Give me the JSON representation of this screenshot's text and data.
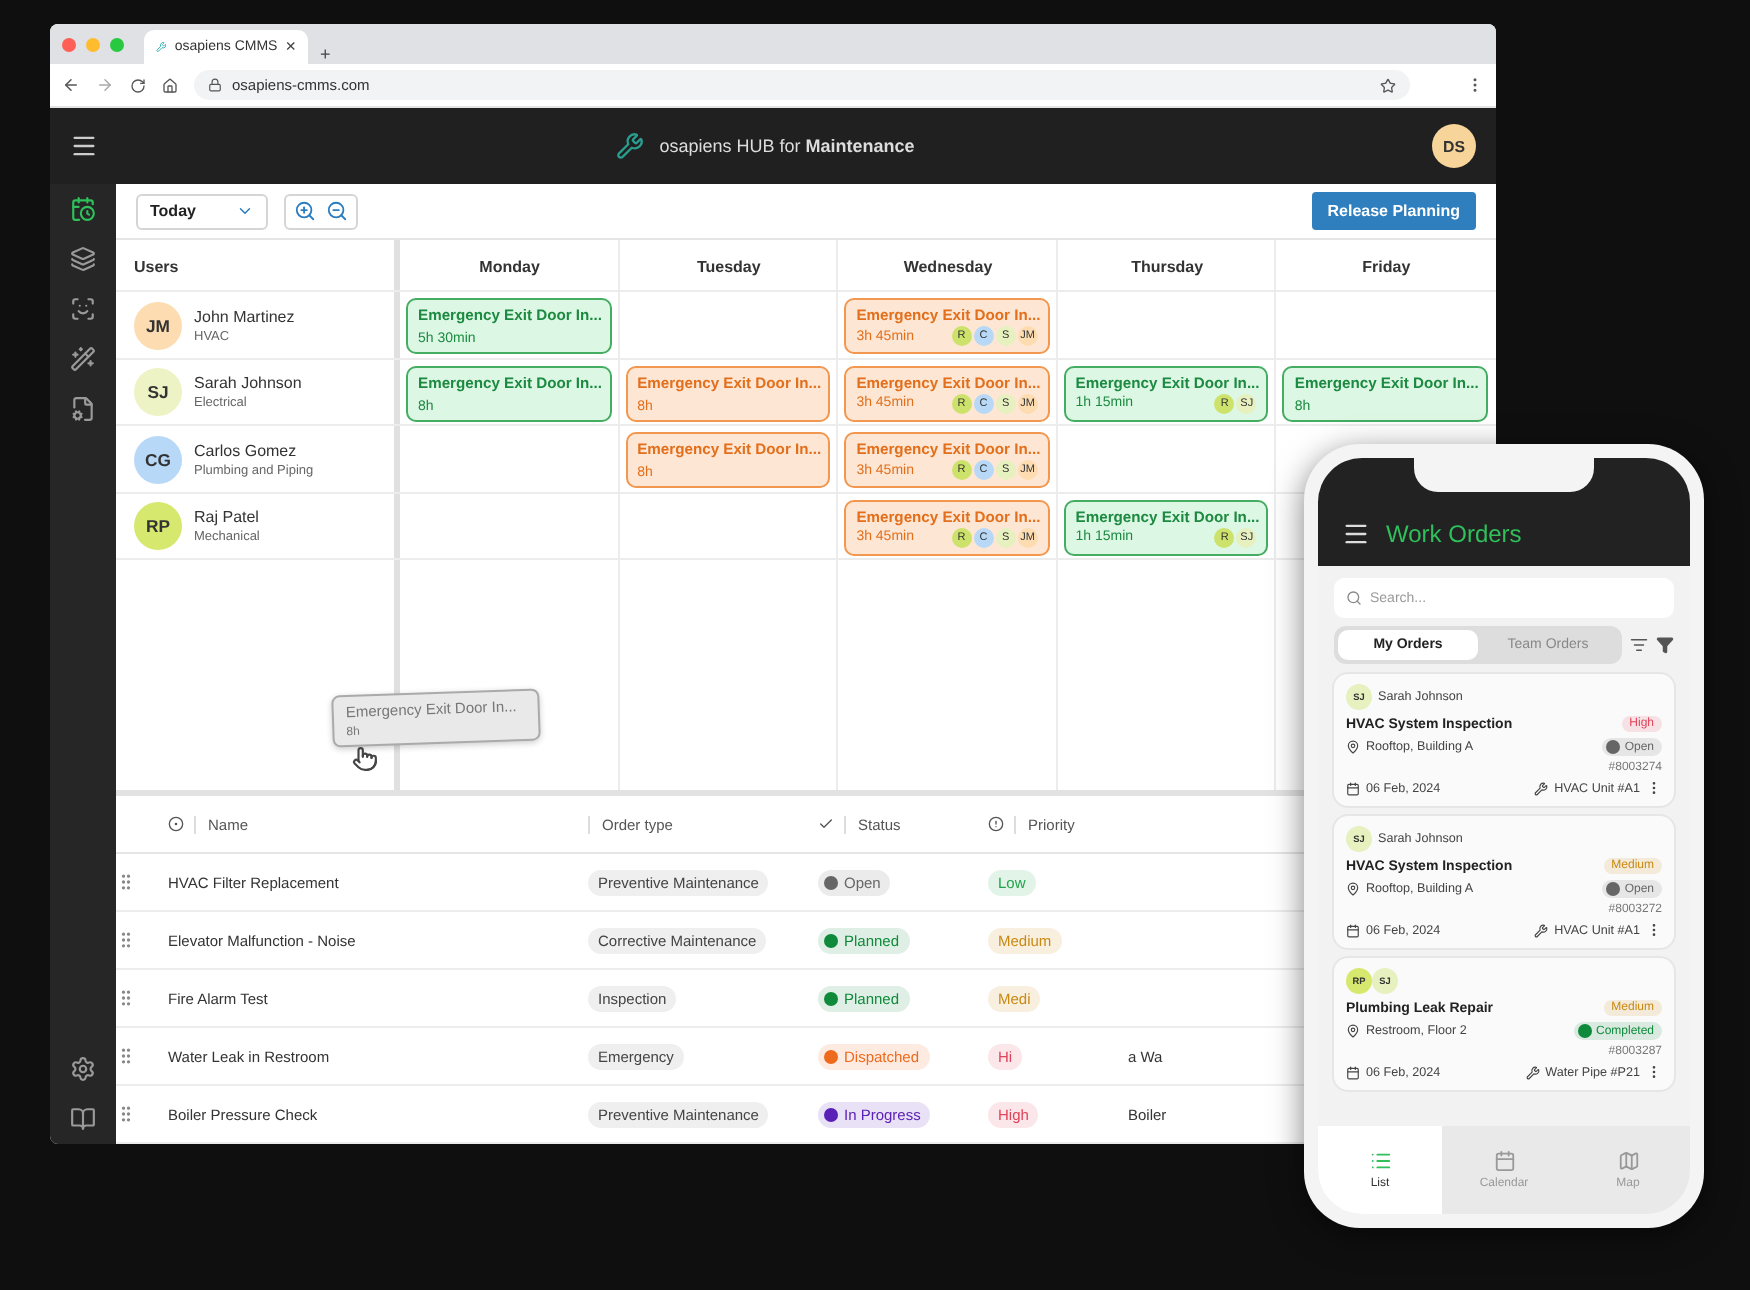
{
  "browser": {
    "tab_title": "osapiens CMMS",
    "tab_close": "×",
    "new_tab": "+",
    "url": "osapiens-cmms.com"
  },
  "header": {
    "title": "osapiens HUB for **Maintenance**",
    "avatar": "DS"
  },
  "sidebar": {
    "items": [
      {
        "kind": "planning",
        "selected": true
      },
      {
        "kind": "layers",
        "selected": false
      },
      {
        "kind": "scan",
        "selected": false
      },
      {
        "kind": "wand",
        "selected": false
      },
      {
        "kind": "file",
        "selected": false
      }
    ],
    "bottom_items": [
      {
        "kind": "settings",
        "selected": false
      },
      {
        "kind": "book",
        "selected": false
      }
    ]
  },
  "toolbar": {
    "date_select": "Today",
    "release_button": "Release Planning"
  },
  "planner": {
    "users_header": "Users",
    "days": [
      "Monday",
      "Tuesday",
      "Wednesday",
      "Thursday",
      "Friday"
    ],
    "users": [
      {
        "initials": "JM",
        "name": "John Martinez",
        "role": "HVAC",
        "color": "#fcdcb0",
        "slots": [
          {
            "kind": "planned",
            "title": "Emergency Exit Door In...",
            "duration": "5h 30min"
          },
          {
            "kind": "empty"
          },
          {
            "kind": "dispatched",
            "title": "Emergency Exit Door In...",
            "duration": "3h 45min",
            "assignees": [
              {
                "initials": "R",
                "color": "#cde26a"
              },
              {
                "initials": "C",
                "color": "#b7d8f7"
              },
              {
                "initials": "S",
                "color": "#e7f0bf"
              },
              {
                "initials": "JM",
                "color": "#fcdcb0"
              }
            ]
          },
          {
            "kind": "empty"
          },
          {
            "kind": "empty"
          }
        ]
      },
      {
        "initials": "SJ",
        "name": "Sarah Johnson",
        "role": "Electrical",
        "color": "#edf3c4",
        "slots": [
          {
            "kind": "planned",
            "title": "Emergency Exit Door In...",
            "duration": "8h"
          },
          {
            "kind": "dispatched",
            "title": "Emergency Exit Door In...",
            "duration": "8h"
          },
          {
            "kind": "dispatched",
            "title": "Emergency Exit Door In...",
            "duration": "3h 45min",
            "assignees": [
              {
                "initials": "R",
                "color": "#cde26a"
              },
              {
                "initials": "C",
                "color": "#b7d8f7"
              },
              {
                "initials": "S",
                "color": "#e7f0bf"
              },
              {
                "initials": "JM",
                "color": "#fcdcb0"
              }
            ]
          },
          {
            "kind": "planned",
            "title": "Emergency Exit Door In...",
            "duration": "1h 15min",
            "assignees": [
              {
                "initials": "R",
                "color": "#cde26a"
              },
              {
                "initials": "SJ",
                "color": "#e7f0bf"
              }
            ]
          },
          {
            "kind": "planned",
            "title": "Emergency Exit Door In...",
            "duration": "8h"
          }
        ]
      },
      {
        "initials": "CG",
        "name": "Carlos Gomez",
        "role": "Plumbing and Piping",
        "color": "#b7d8f7",
        "slots": [
          {
            "kind": "empty"
          },
          {
            "kind": "dispatched",
            "title": "Emergency Exit Door In...",
            "duration": "8h"
          },
          {
            "kind": "dispatched",
            "title": "Emergency Exit Door In...",
            "duration": "3h 45min",
            "assignees": [
              {
                "initials": "R",
                "color": "#cde26a"
              },
              {
                "initials": "C",
                "color": "#b7d8f7"
              },
              {
                "initials": "S",
                "color": "#e7f0bf"
              },
              {
                "initials": "JM",
                "color": "#fcdcb0"
              }
            ]
          },
          {
            "kind": "empty"
          },
          {
            "kind": "empty"
          }
        ]
      },
      {
        "initials": "RP",
        "name": "Raj Patel",
        "role": "Mechanical",
        "color": "#d6e86e",
        "slots": [
          {
            "kind": "empty"
          },
          {
            "kind": "empty"
          },
          {
            "kind": "dispatched",
            "title": "Emergency Exit Door In...",
            "duration": "3h 45min",
            "assignees": [
              {
                "initials": "R",
                "color": "#cde26a"
              },
              {
                "initials": "C",
                "color": "#b7d8f7"
              },
              {
                "initials": "S",
                "color": "#e7f0bf"
              },
              {
                "initials": "JM",
                "color": "#fcdcb0"
              }
            ]
          },
          {
            "kind": "planned",
            "title": "Emergency Exit Door In...",
            "duration": "1h 15min",
            "assignees": [
              {
                "initials": "R",
                "color": "#cde26a"
              },
              {
                "initials": "SJ",
                "color": "#e7f0bf"
              }
            ]
          },
          {
            "kind": "empty"
          }
        ]
      }
    ],
    "drag_preview": {
      "title": "Emergency Exit Door In...",
      "duration": "8h"
    }
  },
  "table": {
    "columns": [
      {
        "label": "Name",
        "kind": "name"
      },
      {
        "label": "Order type",
        "kind": "type"
      },
      {
        "label": "Status",
        "kind": "status"
      },
      {
        "label": "Priority",
        "kind": "priority"
      }
    ],
    "rows": [
      {
        "name": "HVAC Filter Replacement",
        "order_type": "Preventive Maintenance",
        "status": {
          "label": "Open",
          "color": "#666666"
        },
        "priority": {
          "label": "Low",
          "color": "#22a34a"
        }
      },
      {
        "name": "Elevator Malfunction - Noise",
        "order_type": "Corrective Maintenance",
        "status": {
          "label": "Planned",
          "color": "#0e8a3a"
        },
        "priority": {
          "label": "Medium",
          "color": "#c98a12"
        }
      },
      {
        "name": "Fire Alarm Test",
        "order_type": "Inspection",
        "status": {
          "label": "Planned",
          "color": "#0e8a3a"
        },
        "priority": {
          "label": "Medi",
          "color": "#c98a12"
        }
      },
      {
        "name": "Water Leak in Restroom",
        "order_type": "Emergency",
        "status": {
          "label": "Dispatched",
          "color": "#ee6a1c"
        },
        "priority": {
          "label": "Hi",
          "color": "#e0435a"
        },
        "column_5": "a Wa"
      },
      {
        "name": "Boiler Pressure Check",
        "order_type": "Preventive Maintenance",
        "status": {
          "label": "In Progress",
          "color": "#5b21b6"
        },
        "priority": {
          "label": "High",
          "color": "#e0435a"
        },
        "column_5": "Boiler"
      }
    ]
  },
  "phone": {
    "title": "Work Orders",
    "search_placeholder": "Search...",
    "tabs": [
      {
        "label": "My Orders",
        "selected": true
      },
      {
        "label": "Team Orders",
        "selected": false
      }
    ],
    "orders": [
      {
        "assignees": [
          {
            "initials": "SJ",
            "color": "#e7f0bf"
          }
        ],
        "assignee_name": "Sarah Johnson",
        "title": "HVAC System Inspection",
        "location": "Rooftop, Building A",
        "date": "06 Feb, 2024",
        "priority": {
          "label": "High",
          "color": "#e0435a"
        },
        "status": {
          "label": "Open",
          "color": "#666666"
        },
        "number": "#8003274",
        "asset": "HVAC Unit #A1"
      },
      {
        "assignees": [
          {
            "initials": "SJ",
            "color": "#e7f0bf"
          }
        ],
        "assignee_name": "Sarah Johnson",
        "title": "HVAC System Inspection",
        "location": "Rooftop, Building A",
        "date": "06 Feb, 2024",
        "priority": {
          "label": "Medium",
          "color": "#c98a12"
        },
        "status": {
          "label": "Open",
          "color": "#666666"
        },
        "number": "#8003272",
        "asset": "HVAC Unit #A1"
      },
      {
        "assignees": [
          {
            "initials": "RP",
            "color": "#d6e86e"
          },
          {
            "initials": "SJ",
            "color": "#e7f0bf"
          }
        ],
        "title": "Plumbing Leak Repair",
        "location": "Restroom, Floor 2",
        "date": "06 Feb, 2024",
        "priority": {
          "label": "Medium",
          "color": "#c98a12"
        },
        "status": {
          "label": "Completed",
          "color": "#0e8a3a"
        },
        "number": "#8003287",
        "asset": "Water Pipe #P21"
      }
    ],
    "nav": [
      {
        "label": "List",
        "kind": "list",
        "selected": true
      },
      {
        "label": "Calendar",
        "kind": "calendar",
        "selected": false
      },
      {
        "label": "Map",
        "kind": "map",
        "selected": false
      }
    ]
  }
}
